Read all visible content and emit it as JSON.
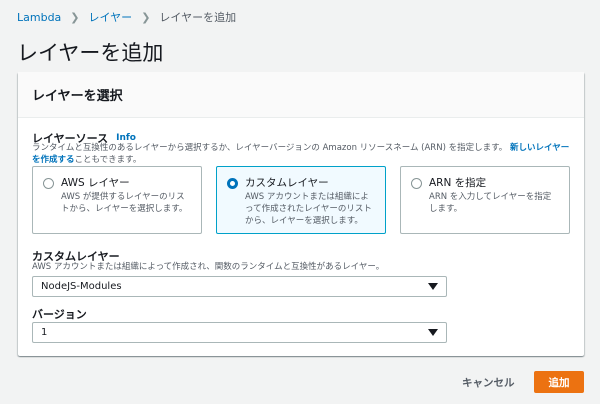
{
  "breadcrumb": {
    "items": [
      "Lambda",
      "レイヤー"
    ],
    "current": "レイヤーを追加"
  },
  "page_title": "レイヤーを追加",
  "panel": {
    "title": "レイヤーを選択",
    "source": {
      "label": "レイヤーソース",
      "info": "Info",
      "desc_part1": "ランタイムと互換性のあるレイヤーから選択するか、レイヤーバージョンの Amazon リソースネーム (ARN) を指定します。",
      "desc_link": "新しいレイヤーを作成する",
      "desc_part2": "こともできます。"
    },
    "options": [
      {
        "title": "AWS レイヤー",
        "desc": "AWS が提供するレイヤーのリストから、レイヤーを選択します。",
        "selected": false
      },
      {
        "title": "カスタムレイヤー",
        "desc": "AWS アカウントまたは組織によって作成されたレイヤーのリストから、レイヤーを選択します。",
        "selected": true
      },
      {
        "title": "ARN を指定",
        "desc": "ARN を入力してレイヤーを指定します。",
        "selected": false
      }
    ],
    "custom_layer": {
      "label": "カスタムレイヤー",
      "desc": "AWS アカウントまたは組織によって作成され、関数のランタイムと互換性があるレイヤー。",
      "value": "NodeJS-Modules"
    },
    "version": {
      "label": "バージョン",
      "value": "1"
    }
  },
  "actions": {
    "cancel": "キャンセル",
    "add": "追加"
  },
  "colors": {
    "accent": "#ec7211",
    "link": "#0073bb",
    "selected_border": "#00a1c9"
  }
}
